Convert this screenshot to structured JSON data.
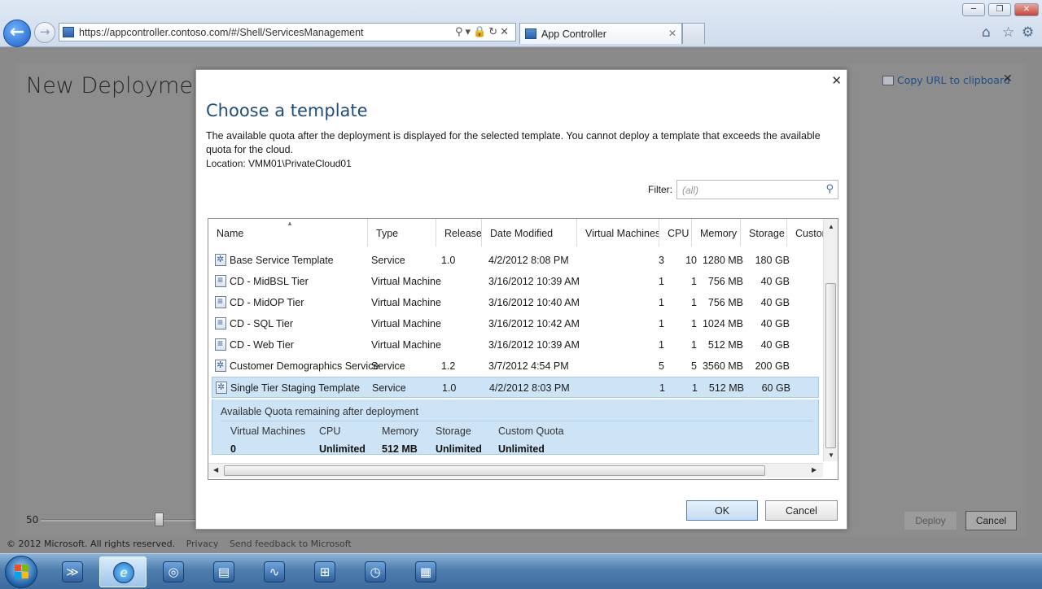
{
  "browser": {
    "url": "https://appcontroller.contoso.com/#/Shell/ServicesManagement",
    "tab_title": "App Controller",
    "window_buttons": [
      "─",
      "❐",
      "✕"
    ]
  },
  "background_page": {
    "title": "New Deployment",
    "copy_url_label": "Copy URL to clipboard",
    "slider_value": "50",
    "deploy_label": "Deploy",
    "cancel_label": "Cancel",
    "footer": {
      "copyright": "© 2012 Microsoft. All rights reserved.",
      "privacy": "Privacy",
      "feedback": "Send feedback to Microsoft"
    }
  },
  "dialog": {
    "title": "Choose a template",
    "description": "The available quota after the deployment is displayed for the selected template. You cannot deploy a template that exceeds the available quota for the cloud.",
    "location": "Location: VMM01\\PrivateCloud01",
    "filter_label": "Filter:",
    "filter_placeholder": "(all)",
    "ok_label": "OK",
    "cancel_label": "Cancel",
    "columns": [
      "Name",
      "Type",
      "Release",
      "Date Modified",
      "Virtual Machines",
      "CPU",
      "Memory",
      "Storage",
      "Custom"
    ],
    "rows": [
      {
        "icon": "service-template-icon",
        "name": "Base Service Template",
        "type": "Service",
        "release": "1.0",
        "date": "4/2/2012 8:08 PM",
        "vms": "3",
        "cpu": "10",
        "memory": "1280 MB",
        "storage": "180 GB"
      },
      {
        "icon": "vm-template-icon",
        "name": "CD - MidBSL Tier",
        "type": "Virtual Machine",
        "release": "",
        "date": "3/16/2012 10:39 AM",
        "vms": "1",
        "cpu": "1",
        "memory": "756 MB",
        "storage": "40 GB"
      },
      {
        "icon": "vm-template-icon",
        "name": "CD - MidOP Tier",
        "type": "Virtual Machine",
        "release": "",
        "date": "3/16/2012 10:40 AM",
        "vms": "1",
        "cpu": "1",
        "memory": "756 MB",
        "storage": "40 GB"
      },
      {
        "icon": "vm-template-icon",
        "name": "CD - SQL Tier",
        "type": "Virtual Machine",
        "release": "",
        "date": "3/16/2012 10:42 AM",
        "vms": "1",
        "cpu": "1",
        "memory": "1024 MB",
        "storage": "40 GB"
      },
      {
        "icon": "vm-template-icon",
        "name": "CD - Web Tier",
        "type": "Virtual Machine",
        "release": "",
        "date": "3/16/2012 10:39 AM",
        "vms": "1",
        "cpu": "1",
        "memory": "512 MB",
        "storage": "40 GB"
      },
      {
        "icon": "service-template-icon",
        "name": "Customer Demographics Service",
        "type": "Service",
        "release": "1.2",
        "date": "3/7/2012 4:54 PM",
        "vms": "5",
        "cpu": "5",
        "memory": "3560 MB",
        "storage": "200 GB"
      },
      {
        "icon": "service-template-icon",
        "name": "Single Tier Staging Template",
        "type": "Service",
        "release": "1.0",
        "date": "4/2/2012 8:03 PM",
        "vms": "1",
        "cpu": "1",
        "memory": "512 MB",
        "storage": "60 GB"
      }
    ],
    "quota": {
      "title": "Available Quota remaining after deployment",
      "headers": [
        "Virtual Machines",
        "CPU",
        "Memory",
        "Storage",
        "Custom Quota"
      ],
      "values": [
        "0",
        "Unlimited",
        "512 MB",
        "Unlimited",
        "Unlimited"
      ]
    }
  },
  "taskbar": {
    "apps": [
      "powershell-icon",
      "internet-explorer-icon",
      "app-icon-3",
      "app-icon-4",
      "performance-monitor-icon",
      "network-icon",
      "task-scheduler-icon",
      "app-icon-8"
    ]
  }
}
